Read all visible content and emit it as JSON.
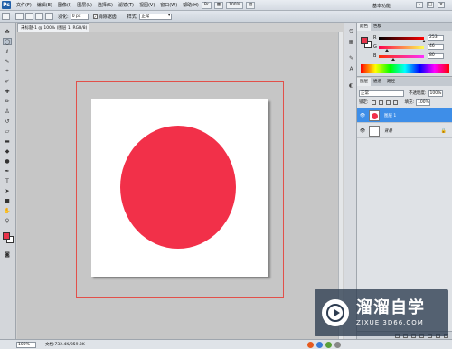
{
  "app": {
    "logo": "Ps"
  },
  "menu": {
    "items": [
      "文件(F)",
      "编辑(E)",
      "图像(I)",
      "图层(L)",
      "选择(S)",
      "滤镜(T)",
      "视图(V)",
      "窗口(W)",
      "帮助(H)"
    ],
    "zoom": "100%",
    "workspace": "基本功能"
  },
  "options": {
    "feather_label": "羽化:",
    "feather_value": "0 px",
    "antialias_label": "消除锯齿",
    "style_label": "样式:",
    "style_value": "正常"
  },
  "document": {
    "tab_title": "未标题-1 @ 100% (图层 1, RGB/8)",
    "circle_color": "#f23049"
  },
  "colors": {
    "foreground": "#e8334a",
    "background": "#ffffff"
  },
  "color_panel": {
    "tabs": [
      "颜色",
      "色板"
    ],
    "sliders": [
      {
        "label": "R",
        "value": "253",
        "fraction": 0.99
      },
      {
        "label": "G",
        "value": "46",
        "fraction": 0.18
      },
      {
        "label": "B",
        "value": "80",
        "fraction": 0.31
      }
    ]
  },
  "layers_panel": {
    "tabs": [
      "图层",
      "通道",
      "路径"
    ],
    "blend_mode": "正常",
    "opacity_label": "不透明度:",
    "opacity_value": "100%",
    "lock_label": "锁定:",
    "fill_label": "填充:",
    "fill_value": "100%",
    "layers": [
      {
        "name": "图层 1",
        "selected": true
      },
      {
        "name": "背景",
        "selected": false,
        "locked": true
      }
    ]
  },
  "status": {
    "zoom": "100%",
    "doc_info": "文档:732.4K/859.3K"
  },
  "watermark": {
    "title": "溜溜自学",
    "url": "ZIXUE.3D66.COM"
  }
}
